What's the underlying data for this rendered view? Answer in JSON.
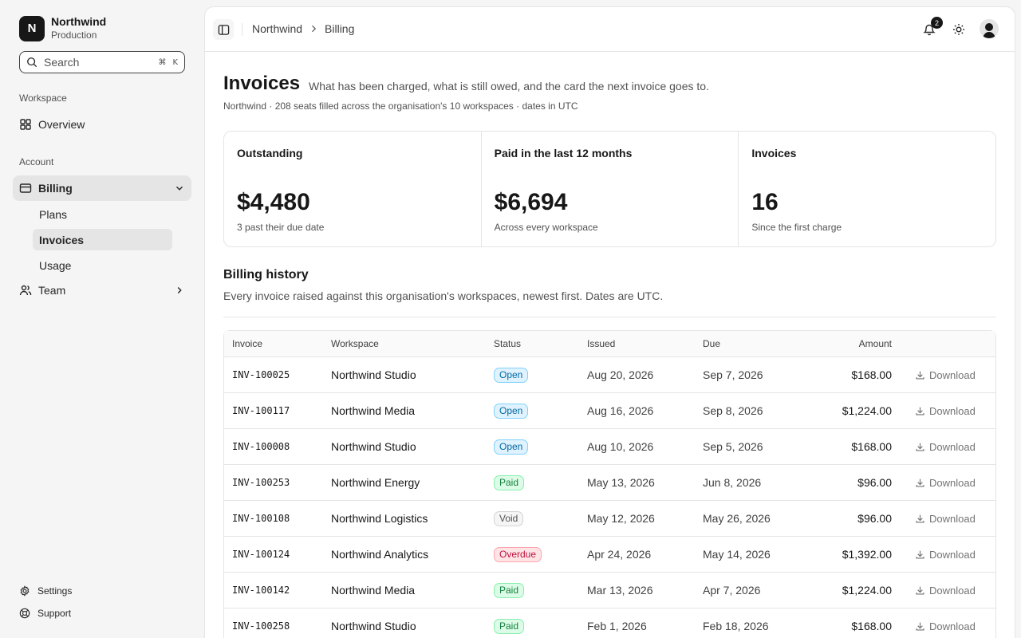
{
  "org": {
    "initial": "N",
    "name": "Northwind",
    "env": "Production"
  },
  "search": {
    "placeholder": "Search",
    "shortcut_mod": "⌘",
    "shortcut_key": "K"
  },
  "sidebar": {
    "workspace_label": "Workspace",
    "overview": "Overview",
    "account_label": "Account",
    "billing": "Billing",
    "billing_sub": [
      "Plans",
      "Invoices",
      "Usage"
    ],
    "team": "Team",
    "settings": "Settings",
    "support": "Support"
  },
  "breadcrumb": [
    "Northwind",
    "Billing"
  ],
  "notifications": {
    "count": "2"
  },
  "page": {
    "title": "Invoices",
    "subtitle": "What has been charged, what is still owed, and the card the next invoice goes to.",
    "meta": "Northwind · 208 seats filled across the organisation's 10 workspaces · dates in UTC"
  },
  "stats": [
    {
      "label": "Outstanding",
      "value": "$4,480",
      "note": "3 past their due date"
    },
    {
      "label": "Paid in the last 12 months",
      "value": "$6,694",
      "note": "Across every workspace"
    },
    {
      "label": "Invoices",
      "value": "16",
      "note": "Since the first charge"
    }
  ],
  "history": {
    "title": "Billing history",
    "subtitle": "Every invoice raised against this organisation's workspaces, newest first. Dates are UTC.",
    "columns": [
      "Invoice",
      "Workspace",
      "Status",
      "Issued",
      "Due",
      "Amount"
    ],
    "download_label": "Download",
    "rows": [
      {
        "id": "INV-100025",
        "workspace": "Northwind Studio",
        "status": "Open",
        "status_kind": "open",
        "issued": "Aug 20, 2026",
        "due": "Sep 7, 2026",
        "amount": "$168.00"
      },
      {
        "id": "INV-100117",
        "workspace": "Northwind Media",
        "status": "Open",
        "status_kind": "open",
        "issued": "Aug 16, 2026",
        "due": "Sep 8, 2026",
        "amount": "$1,224.00"
      },
      {
        "id": "INV-100008",
        "workspace": "Northwind Studio",
        "status": "Open",
        "status_kind": "open",
        "issued": "Aug 10, 2026",
        "due": "Sep 5, 2026",
        "amount": "$168.00"
      },
      {
        "id": "INV-100253",
        "workspace": "Northwind Energy",
        "status": "Paid",
        "status_kind": "paid",
        "issued": "May 13, 2026",
        "due": "Jun 8, 2026",
        "amount": "$96.00"
      },
      {
        "id": "INV-100108",
        "workspace": "Northwind Logistics",
        "status": "Void",
        "status_kind": "void",
        "issued": "May 12, 2026",
        "due": "May 26, 2026",
        "amount": "$96.00"
      },
      {
        "id": "INV-100124",
        "workspace": "Northwind Analytics",
        "status": "Overdue",
        "status_kind": "overdue",
        "issued": "Apr 24, 2026",
        "due": "May 14, 2026",
        "amount": "$1,392.00"
      },
      {
        "id": "INV-100142",
        "workspace": "Northwind Media",
        "status": "Paid",
        "status_kind": "paid",
        "issued": "Mar 13, 2026",
        "due": "Apr 7, 2026",
        "amount": "$1,224.00"
      },
      {
        "id": "INV-100258",
        "workspace": "Northwind Studio",
        "status": "Paid",
        "status_kind": "paid",
        "issued": "Feb 1, 2026",
        "due": "Feb 18, 2026",
        "amount": "$168.00"
      }
    ]
  }
}
